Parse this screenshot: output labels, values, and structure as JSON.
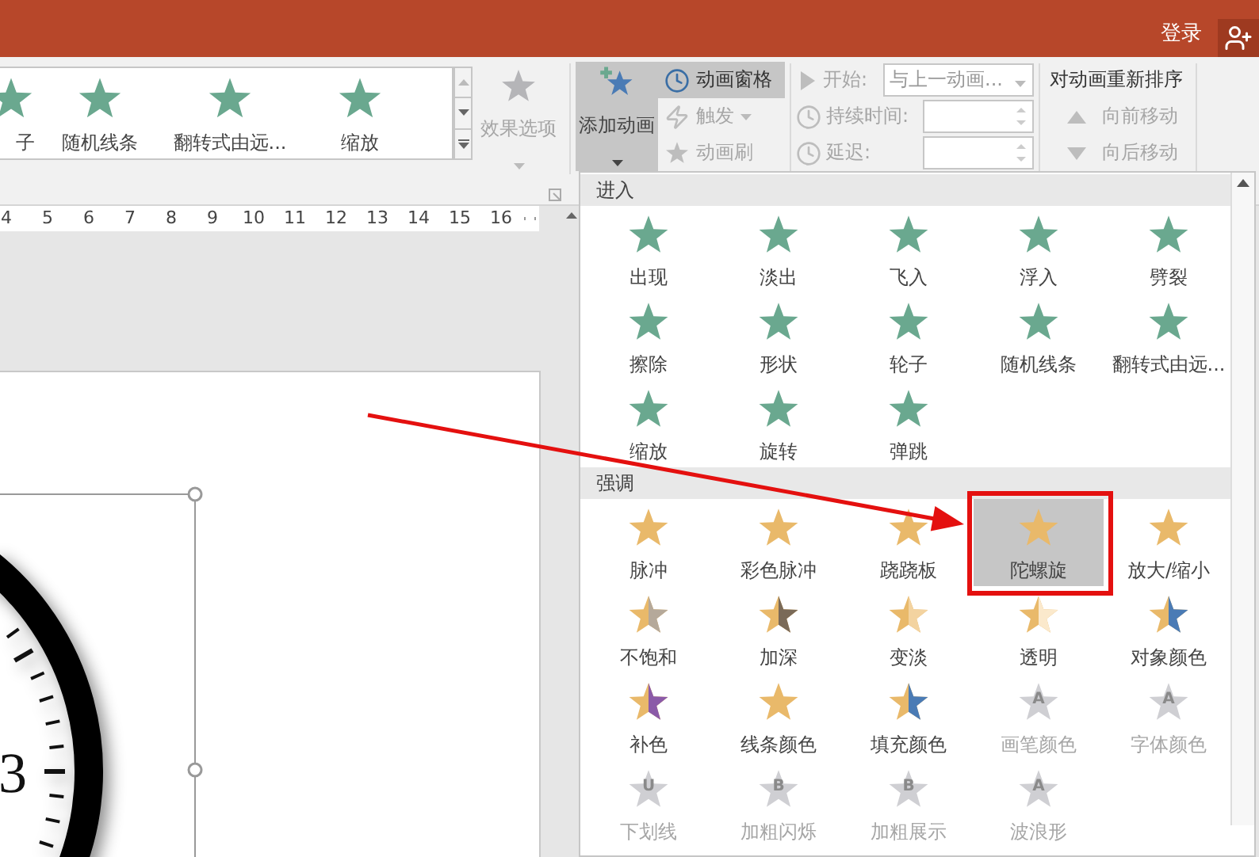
{
  "title_bar": {
    "sign_in": "登录"
  },
  "ribbon": {
    "gallery": [
      {
        "label": "子"
      },
      {
        "label": "随机线条"
      },
      {
        "label": "翻转式由远..."
      },
      {
        "label": "缩放"
      }
    ],
    "effect_options": {
      "label": "效果选项",
      "disabled": true
    },
    "add_animation": {
      "label": "添加动画",
      "pressed": true
    },
    "advanced": [
      {
        "label": "动画窗格",
        "pressed": true,
        "disabled": false,
        "dropdown": false
      },
      {
        "label": "触发",
        "pressed": false,
        "disabled": true,
        "dropdown": true
      },
      {
        "label": "动画刷",
        "pressed": false,
        "disabled": true,
        "dropdown": false
      }
    ],
    "timing": [
      {
        "kind": "dropdown",
        "label": "开始:",
        "value": "与上一动画...",
        "disabled": true
      },
      {
        "kind": "spinner",
        "label": "持续时间:",
        "disabled": true
      },
      {
        "kind": "spinner",
        "label": "延迟:",
        "disabled": true
      }
    ],
    "reorder": {
      "title": "对动画重新排序",
      "buttons": [
        {
          "label": "向前移动",
          "kind": "up",
          "disabled": true
        },
        {
          "label": "向后移动",
          "kind": "down",
          "disabled": true
        }
      ]
    }
  },
  "ruler": [
    "4",
    "5",
    "6",
    "7",
    "8",
    "9",
    "10",
    "11",
    "12",
    "13",
    "14",
    "15",
    "16"
  ],
  "slide": {
    "clock_numeral": "3"
  },
  "animation_menu": {
    "sections": [
      {
        "title": "进入",
        "kind": "entrance",
        "items": [
          {
            "label": "出现",
            "selected": false,
            "disabled": false
          },
          {
            "label": "淡出",
            "selected": false,
            "disabled": false
          },
          {
            "label": "飞入",
            "selected": false,
            "disabled": false
          },
          {
            "label": "浮入",
            "selected": false,
            "disabled": false
          },
          {
            "label": "劈裂",
            "selected": false,
            "disabled": false
          },
          {
            "label": "擦除",
            "selected": false,
            "disabled": false
          },
          {
            "label": "形状",
            "selected": false,
            "disabled": false
          },
          {
            "label": "轮子",
            "selected": false,
            "disabled": false
          },
          {
            "label": "随机线条",
            "selected": false,
            "disabled": false
          },
          {
            "label": "翻转式由远...",
            "selected": false,
            "disabled": false
          },
          {
            "label": "缩放",
            "selected": false,
            "disabled": false
          },
          {
            "label": "旋转",
            "selected": false,
            "disabled": false
          },
          {
            "label": "弹跳",
            "selected": false,
            "disabled": false
          }
        ]
      },
      {
        "title": "强调",
        "kind": "emphasis",
        "items": [
          {
            "label": "脉冲",
            "selected": false,
            "disabled": false
          },
          {
            "label": "彩色脉冲",
            "selected": false,
            "disabled": false
          },
          {
            "label": "跷跷板",
            "selected": false,
            "disabled": false
          },
          {
            "label": "陀螺旋",
            "selected": true,
            "disabled": false
          },
          {
            "label": "放大/缩小",
            "selected": false,
            "disabled": false
          },
          {
            "label": "不饱和",
            "selected": false,
            "disabled": false,
            "color": "#b5a99a"
          },
          {
            "label": "加深",
            "selected": false,
            "disabled": false,
            "color": "#7a6a58"
          },
          {
            "label": "变淡",
            "selected": false,
            "disabled": false,
            "color": "#f3d3a0"
          },
          {
            "label": "透明",
            "selected": false,
            "disabled": false,
            "color": "#fbe9cc"
          },
          {
            "label": "对象颜色",
            "selected": false,
            "disabled": false,
            "color": "#4a7bb5"
          },
          {
            "label": "补色",
            "selected": false,
            "disabled": false,
            "color": "#8b5aa8"
          },
          {
            "label": "线条颜色",
            "selected": false,
            "disabled": false
          },
          {
            "label": "填充颜色",
            "selected": false,
            "disabled": false,
            "color": "#4a7bb5"
          },
          {
            "label": "画笔颜色",
            "selected": false,
            "disabled": true,
            "glyph": "A"
          },
          {
            "label": "字体颜色",
            "selected": false,
            "disabled": true,
            "glyph": "A"
          },
          {
            "label": "下划线",
            "selected": false,
            "disabled": true,
            "glyph": "U"
          },
          {
            "label": "加粗闪烁",
            "selected": false,
            "disabled": true,
            "glyph": "B"
          },
          {
            "label": "加粗展示",
            "selected": false,
            "disabled": true,
            "glyph": "B"
          },
          {
            "label": "波浪形",
            "selected": false,
            "disabled": true,
            "glyph": "A"
          }
        ]
      }
    ]
  }
}
